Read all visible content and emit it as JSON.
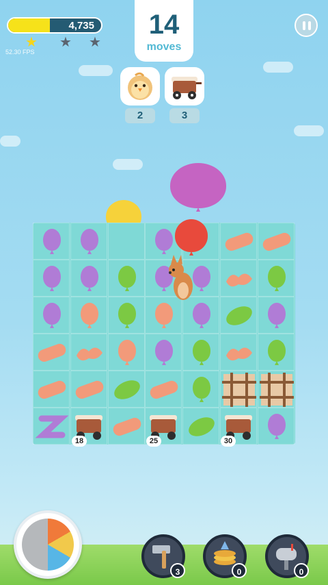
{
  "hud": {
    "score": "4,735",
    "score_progress": 0.45,
    "fps": "52.30 FPS",
    "moves_count": "14",
    "moves_label": "moves"
  },
  "goals": [
    {
      "icon": "chick-icon",
      "count": "2"
    },
    {
      "icon": "wagon-icon",
      "count": "3"
    }
  ],
  "board": {
    "wagons": [
      "18",
      "25",
      "30"
    ]
  },
  "boosters": [
    {
      "icon": "hammer-icon",
      "count": "3"
    },
    {
      "icon": "pancake-stack-icon",
      "count": "0"
    },
    {
      "icon": "mailbox-icon",
      "count": "0"
    }
  ],
  "colors": {
    "purple": "#b07cd6",
    "green": "#7cc943",
    "orange": "#f29a7a",
    "red": "#e84a3c",
    "yellow": "#f6d23a",
    "magenta": "#c564c2"
  }
}
